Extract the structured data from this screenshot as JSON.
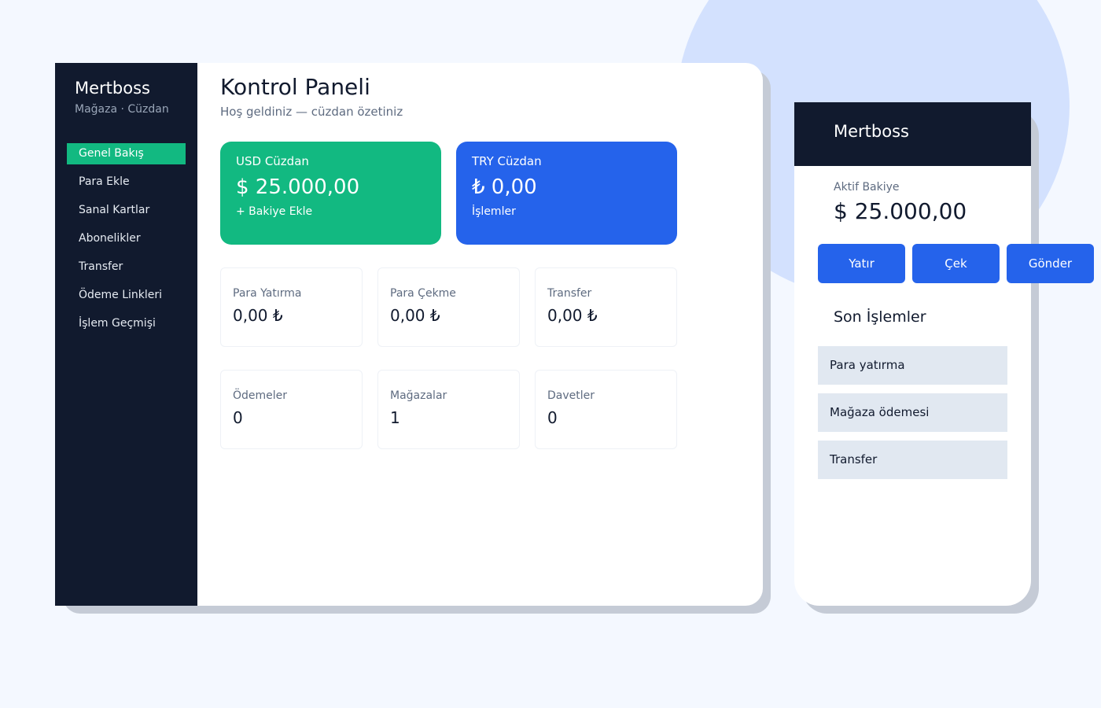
{
  "brand": {
    "name": "Mertboss",
    "subtitle": "Mağaza · Cüzdan"
  },
  "sidebar": {
    "items": [
      {
        "label": "Genel Bakış",
        "active": true
      },
      {
        "label": "Para Ekle"
      },
      {
        "label": "Sanal Kartlar"
      },
      {
        "label": "Abonelikler"
      },
      {
        "label": "Transfer"
      },
      {
        "label": "Ödeme Linkleri"
      },
      {
        "label": "İşlem Geçmişi"
      }
    ]
  },
  "main": {
    "title": "Kontrol Paneli",
    "subtitle": "Hoş geldiniz — cüzdan özetiniz",
    "wallets": [
      {
        "name": "USD Cüzdan",
        "amount": "$ 25.000,00",
        "action": "+ Bakiye Ekle",
        "color": "#12b981"
      },
      {
        "name": "TRY Cüzdan",
        "amount": "₺ 0,00",
        "action": "İşlemler",
        "color": "#2563eb"
      }
    ],
    "stats": [
      {
        "label": "Para Yatırma",
        "value": "0,00 ₺"
      },
      {
        "label": "Para Çekme",
        "value": "0,00 ₺"
      },
      {
        "label": "Transfer",
        "value": "0,00 ₺"
      },
      {
        "label": "Ödemeler",
        "value": "0"
      },
      {
        "label": "Mağazalar",
        "value": "1"
      },
      {
        "label": "Davetler",
        "value": "0"
      }
    ]
  },
  "mobile": {
    "brand": "Mertboss",
    "balance_label": "Aktif Bakiye",
    "balance_value": "$ 25.000,00",
    "buttons": [
      "Yatır",
      "Çek",
      "Gönder"
    ],
    "recent_title": "Son İşlemler",
    "transactions": [
      "Para yatırma",
      "Mağaza ödemesi",
      "Transfer"
    ]
  },
  "colors": {
    "sidebar": "#111a2e",
    "accent_green": "#12b981",
    "accent_blue": "#2563eb"
  }
}
